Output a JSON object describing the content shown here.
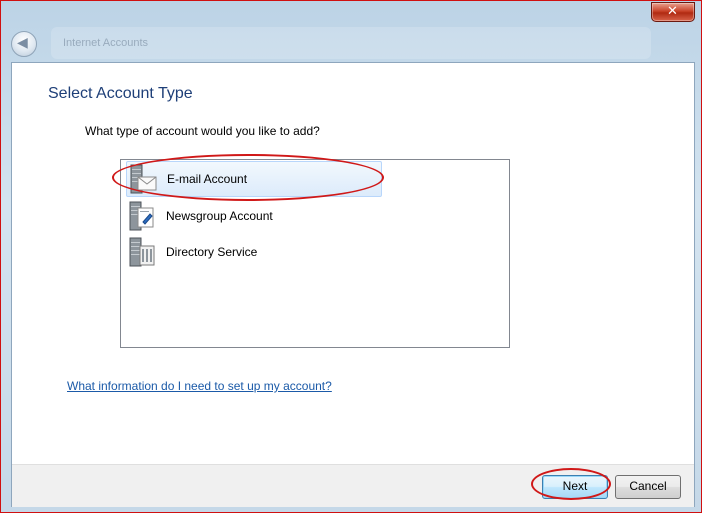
{
  "window": {
    "title": "Internet Accounts",
    "close_glyph": "✕",
    "back_glyph": "◀"
  },
  "page": {
    "heading": "Select Account Type",
    "question": "What type of account would you like to add?",
    "help_link": "What information do I need to set up my account?"
  },
  "account_types": {
    "items": [
      {
        "label": "E-mail Account",
        "icon": "email-server-icon",
        "selected": true
      },
      {
        "label": "Newsgroup Account",
        "icon": "newsgroup-server-icon",
        "selected": false
      },
      {
        "label": "Directory Service",
        "icon": "directory-server-icon",
        "selected": false
      }
    ]
  },
  "footer": {
    "next_label": "Next",
    "cancel_label": "Cancel"
  },
  "colors": {
    "heading": "#1e3f78",
    "link": "#1b5aa8",
    "annotation_ring": "#d01818",
    "selection": "#dcebfb"
  }
}
